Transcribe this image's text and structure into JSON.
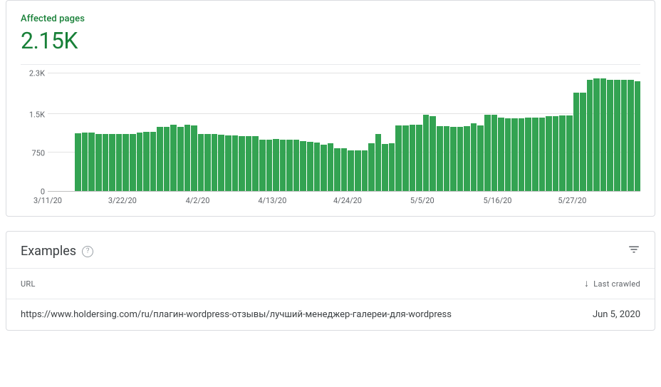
{
  "card_header": {
    "label": "Affected pages",
    "value": "2.15K"
  },
  "chart_data": {
    "type": "bar",
    "title": "Affected pages",
    "xlabel": "",
    "ylabel": "",
    "ylim": [
      0,
      2300
    ],
    "y_ticks": [
      "0",
      "750",
      "1.5K",
      "2.3K"
    ],
    "x_tick_labels": [
      "3/11/20",
      "3/22/20",
      "4/2/20",
      "4/13/20",
      "4/24/20",
      "5/5/20",
      "5/16/20",
      "5/27/20"
    ],
    "x_tick_positions": [
      0.0,
      0.126,
      0.253,
      0.379,
      0.506,
      0.632,
      0.759,
      0.885
    ],
    "categories": [
      "3/11/20",
      "3/12/20",
      "3/13/20",
      "3/14/20",
      "3/15/20",
      "3/16/20",
      "3/17/20",
      "3/18/20",
      "3/19/20",
      "3/20/20",
      "3/21/20",
      "3/22/20",
      "3/23/20",
      "3/24/20",
      "3/25/20",
      "3/26/20",
      "3/27/20",
      "3/28/20",
      "3/29/20",
      "3/30/20",
      "3/31/20",
      "4/1/20",
      "4/2/20",
      "4/3/20",
      "4/4/20",
      "4/5/20",
      "4/6/20",
      "4/7/20",
      "4/8/20",
      "4/9/20",
      "4/10/20",
      "4/11/20",
      "4/12/20",
      "4/13/20",
      "4/14/20",
      "4/15/20",
      "4/16/20",
      "4/17/20",
      "4/18/20",
      "4/19/20",
      "4/20/20",
      "4/21/20",
      "4/22/20",
      "4/23/20",
      "4/24/20",
      "4/25/20",
      "4/26/20",
      "4/27/20",
      "4/28/20",
      "4/29/20",
      "4/30/20",
      "5/1/20",
      "5/2/20",
      "5/3/20",
      "5/4/20",
      "5/5/20",
      "5/6/20",
      "5/7/20",
      "5/8/20",
      "5/9/20",
      "5/10/20",
      "5/11/20",
      "5/12/20",
      "5/13/20",
      "5/14/20",
      "5/15/20",
      "5/16/20",
      "5/17/20",
      "5/18/20",
      "5/19/20",
      "5/20/20",
      "5/21/20",
      "5/22/20",
      "5/23/20",
      "5/24/20",
      "5/25/20",
      "5/26/20",
      "5/27/20",
      "5/28/20",
      "5/29/20",
      "5/30/20",
      "5/31/20",
      "6/1/20",
      "6/2/20",
      "6/3/20",
      "6/4/20",
      "6/5/20"
    ],
    "values": [
      null,
      null,
      null,
      null,
      1130,
      1140,
      1140,
      1120,
      1110,
      1120,
      1120,
      1120,
      1120,
      1150,
      1160,
      1160,
      1250,
      1260,
      1300,
      1260,
      1300,
      1280,
      1120,
      1120,
      1110,
      1100,
      1090,
      1090,
      1070,
      1070,
      1070,
      1000,
      1010,
      1020,
      1010,
      1010,
      1000,
      970,
      960,
      950,
      900,
      930,
      840,
      840,
      800,
      800,
      800,
      940,
      1110,
      920,
      930,
      1280,
      1280,
      1290,
      1300,
      1490,
      1470,
      1270,
      1270,
      1260,
      1260,
      1270,
      1320,
      1280,
      1490,
      1490,
      1440,
      1420,
      1420,
      1420,
      1440,
      1430,
      1430,
      1470,
      1470,
      1480,
      1480,
      1920,
      1920,
      2180,
      2200,
      2200,
      2170,
      2170,
      2170,
      2170,
      2150
    ]
  },
  "examples": {
    "title": "Examples",
    "col_url": "URL",
    "col_last_crawled": "Last crawled",
    "rows": [
      {
        "url": "https://www.holdersing.com/ru/плагин-wordpress-отзывы/лучший-менеджер-галереи-для-wordpress",
        "last_crawled": "Jun 5, 2020"
      }
    ]
  }
}
